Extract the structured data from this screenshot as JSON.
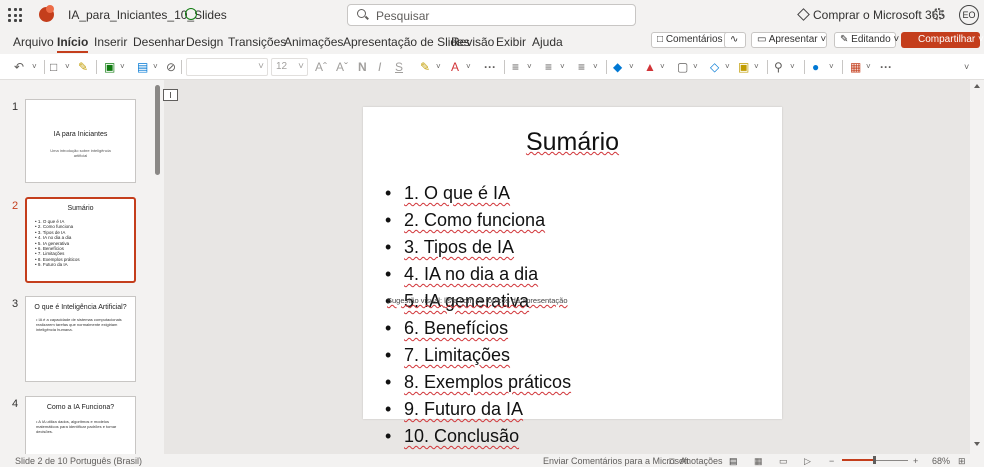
{
  "titlebar": {
    "filename": "IA_para_Iniciantes_10_Slides",
    "search_placeholder": "Pesquisar",
    "buy": "Comprar o Microsoft 365",
    "avatar": "EO"
  },
  "tabs": [
    "Arquivo",
    "Início",
    "Inserir",
    "Desenhar",
    "Design",
    "Transições",
    "Animações",
    "Apresentação de Slides",
    "Revisão",
    "Exibir",
    "Ajuda"
  ],
  "active_tab": "Início",
  "actions": {
    "comments": "Comentários",
    "present": "Apresentar",
    "editing": "Editando",
    "share": "Compartilhar"
  },
  "toolbar": {
    "font_size": "12"
  },
  "thumbnails": [
    {
      "num": "1",
      "title": "IA para Iniciantes",
      "subtitle": "Uma introdução sobre inteligência artificial"
    },
    {
      "num": "2",
      "title": "Sumário",
      "items": [
        "1. O que é IA",
        "2. Como funciona",
        "3. Tipos de IA",
        "4. IA no dia a dia",
        "5. IA generativa",
        "6. Benefícios",
        "7. Limitações",
        "8. Exemplos práticos",
        "9. Futuro da IA"
      ]
    },
    {
      "num": "3",
      "title": "O que é Inteligência Artificial?",
      "body": "IA é a capacidade de sistemas computacionais realizarem tarefas que normalmente exigiriam inteligência humana."
    },
    {
      "num": "4",
      "title": "Como a IA Funciona?",
      "body": "A IA utiliza dados, algoritmos e modelos matemáticos para identificar padrões e tomar decisões."
    }
  ],
  "slide": {
    "title": "Sumário",
    "bullets": [
      "1. O que é IA",
      "2. Como funciona",
      "3. Tipos de IA",
      "4. IA no dia a dia",
      "5. IA generativa",
      "6. Benefícios",
      "7. Limitações",
      "8. Exemplos práticos",
      "9. Futuro da IA",
      "10. Conclusão"
    ],
    "note_prefix": "Sugestão visual: ",
    "note_link": "lista com os tópicos da apresentação"
  },
  "status": {
    "slide_count": "Slide 2 de 10",
    "language": "Português (Brasil)",
    "feedback": "Enviar Comentários para a Microsoft",
    "notes": "Anotações",
    "zoom": "68%"
  }
}
